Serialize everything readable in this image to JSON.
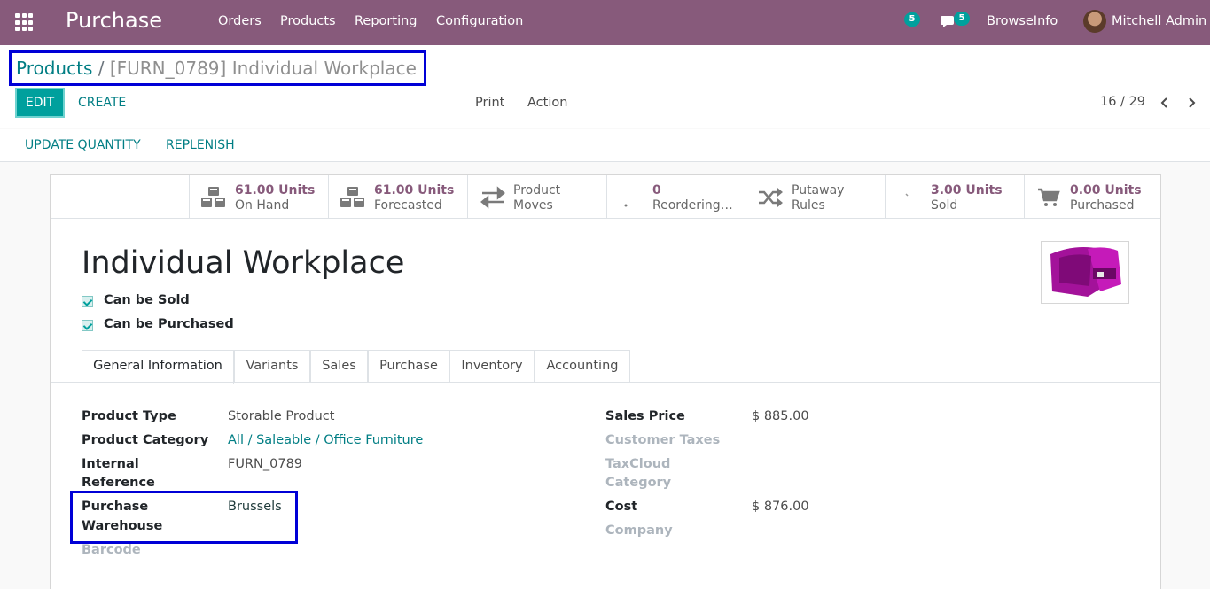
{
  "navbar": {
    "brand": "Purchase",
    "menu": [
      "Orders",
      "Products",
      "Reporting",
      "Configuration"
    ],
    "activity_count": "5",
    "messages_count": "5",
    "company": "BrowseInfo",
    "user": "Mitchell Admin"
  },
  "breadcrumb": {
    "parent": "Products",
    "separator": "/",
    "current": "[FURN_0789] Individual Workplace"
  },
  "buttons": {
    "edit": "EDIT",
    "create": "CREATE",
    "print": "Print",
    "action": "Action"
  },
  "pager": {
    "text": "16 / 29"
  },
  "statusbar": {
    "update_quantity": "UPDATE QUANTITY",
    "replenish": "REPLENISH"
  },
  "stats": [
    {
      "value": "61.00 Units",
      "label": "On Hand",
      "icon": "cubes-icon"
    },
    {
      "value": "61.00 Units",
      "label": "Forecasted",
      "icon": "cubes-icon"
    },
    {
      "value": "Product",
      "label": "Moves",
      "icon": "exchange-arrows-icon"
    },
    {
      "value": "0",
      "label": "Reordering…",
      "icon": "refresh-icon"
    },
    {
      "value": "Putaway",
      "label": "Rules",
      "icon": "random-icon"
    },
    {
      "value": "3.00 Units",
      "label": "Sold",
      "icon": "signal-icon"
    },
    {
      "value": "0.00 Units",
      "label": "Purchased",
      "icon": "cart-icon"
    }
  ],
  "product": {
    "name": "Individual Workplace",
    "can_be_sold": "Can be Sold",
    "can_be_purchased": "Can be Purchased"
  },
  "tabs": [
    "General Information",
    "Variants",
    "Sales",
    "Purchase",
    "Inventory",
    "Accounting"
  ],
  "fields_left": {
    "product_type_label": "Product Type",
    "product_type_value": "Storable Product",
    "category_label": "Product Category",
    "category_value": "All / Saleable / Office Furniture",
    "ref_label_1": "Internal",
    "ref_label_2": "Reference",
    "ref_value": "FURN_0789",
    "wh_label_1": "Purchase",
    "wh_label_2": "Warehouse",
    "wh_value": "Brussels",
    "barcode_label": "Barcode"
  },
  "fields_right": {
    "sales_price_label": "Sales Price",
    "sales_price_value": "$ 885.00",
    "customer_taxes_label": "Customer Taxes",
    "taxcloud_label_1": "TaxCloud",
    "taxcloud_label_2": "Category",
    "cost_label": "Cost",
    "cost_value": "$ 876.00",
    "company_label": "Company"
  },
  "colors": {
    "navbar": "#875a7b",
    "accent": "#00a09d",
    "link": "#017e84",
    "highlight_box": "#0000d6"
  }
}
